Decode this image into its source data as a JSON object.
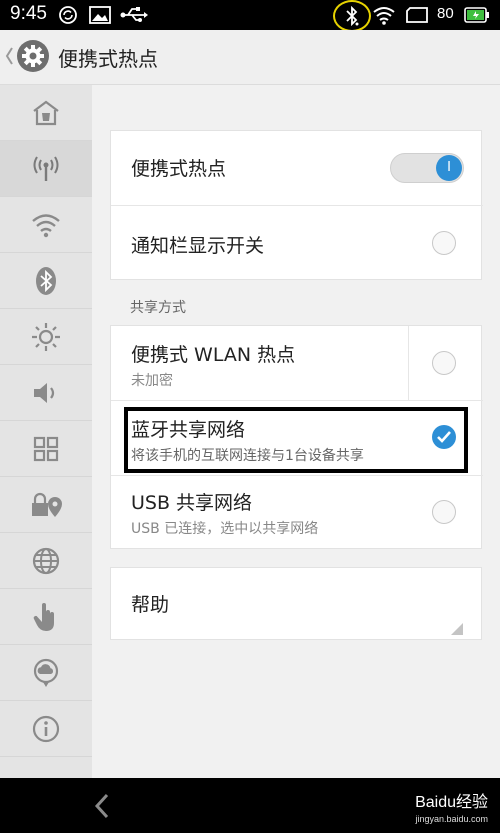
{
  "status_bar": {
    "time": "9:45",
    "battery_level": "80",
    "icons": [
      "sync-icon",
      "image-icon",
      "usb-icon",
      "bluetooth-icon",
      "wifi-icon",
      "tablet-icon",
      "battery-icon"
    ]
  },
  "header": {
    "title": "便携式热点",
    "icons": [
      "back-chevron-icon",
      "settings-gear-icon"
    ]
  },
  "sidebar": {
    "items": [
      {
        "icon": "home-icon"
      },
      {
        "icon": "hotspot-icon",
        "active": true
      },
      {
        "icon": "wifi-icon"
      },
      {
        "icon": "bluetooth-icon"
      },
      {
        "icon": "brightness-icon"
      },
      {
        "icon": "sound-icon"
      },
      {
        "icon": "apps-grid-icon"
      },
      {
        "icon": "lock-location-icon"
      },
      {
        "icon": "globe-icon"
      },
      {
        "icon": "hand-icon"
      },
      {
        "icon": "cloud-chat-icon"
      },
      {
        "icon": "info-icon"
      }
    ]
  },
  "main": {
    "hotspot_card": {
      "hotspot_label": "便携式热点",
      "hotspot_on": true,
      "toggle_text": "I",
      "notify_label": "通知栏显示开关",
      "notify_checked": false
    },
    "section_label": "共享方式",
    "share_card": {
      "items": [
        {
          "title": "便携式 WLAN 热点",
          "subtitle": "未加密",
          "checked": false
        },
        {
          "title": "蓝牙共享网络",
          "subtitle": "将该手机的互联网连接与1台设备共享",
          "checked": true
        },
        {
          "title": "USB 共享网络",
          "subtitle": "USB 已连接，选中以共享网络",
          "checked": false
        }
      ]
    },
    "help_label": "帮助"
  },
  "nav_bar": {
    "back_icon": "back-arrow-icon",
    "watermark": "Baidu经验",
    "watermark_sub": "jingyan.baidu.com"
  },
  "colors": {
    "accent": "#2d8fd6",
    "highlight_circle": "#e6d200",
    "battery_fill": "#3fbf3f"
  }
}
